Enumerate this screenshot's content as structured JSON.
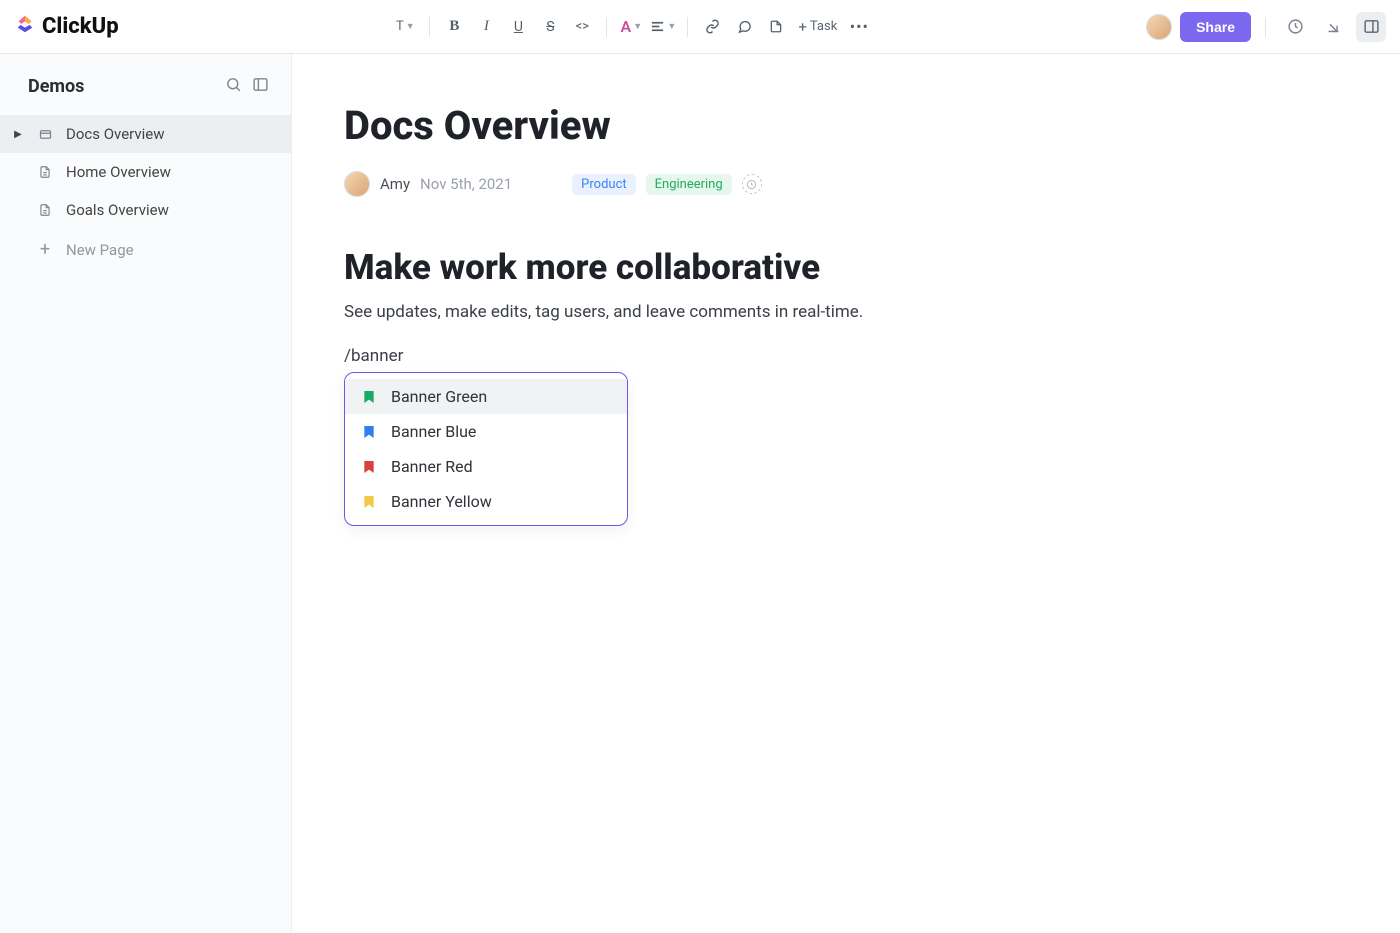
{
  "brand": {
    "name": "ClickUp"
  },
  "toolbar": {
    "text_style": "T",
    "task_label": "Task",
    "share_label": "Share",
    "font_color_letter": "A"
  },
  "sidebar": {
    "title": "Demos",
    "items": [
      {
        "label": "Docs Overview",
        "icon": "doc-stack",
        "selected": true
      },
      {
        "label": "Home Overview",
        "icon": "doc",
        "selected": false
      },
      {
        "label": "Goals Overview",
        "icon": "doc",
        "selected": false
      }
    ],
    "new_page_label": "New Page"
  },
  "doc": {
    "title": "Docs Overview",
    "author": "Amy",
    "date": "Nov 5th, 2021",
    "tags": [
      {
        "label": "Product",
        "variant": "product"
      },
      {
        "label": "Engineering",
        "variant": "eng"
      }
    ],
    "heading": "Make work more collaborative",
    "paragraph": "See updates, make edits, tag users, and leave comments in real-time.",
    "slash_text": "/banner"
  },
  "slash_menu": {
    "items": [
      {
        "label": "Banner Green",
        "color": "#1aaa66",
        "selected": true
      },
      {
        "label": "Banner Blue",
        "color": "#2f80ed",
        "selected": false
      },
      {
        "label": "Banner Red",
        "color": "#d93f3f",
        "selected": false
      },
      {
        "label": "Banner Yellow",
        "color": "#f2c94c",
        "selected": false
      }
    ]
  }
}
